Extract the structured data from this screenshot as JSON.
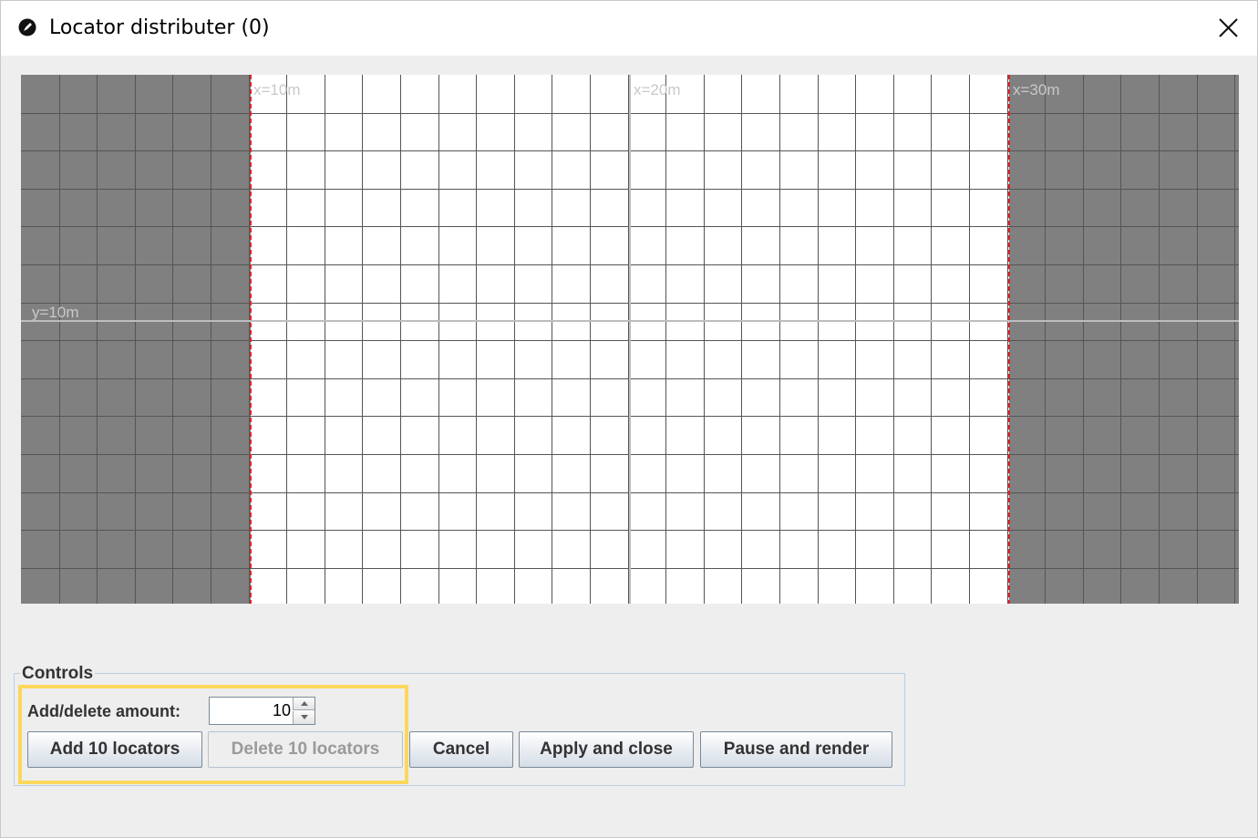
{
  "window": {
    "title": "Locator distributer (0)"
  },
  "canvas": {
    "x_labels": [
      "x=10m",
      "x=20m",
      "x=30m"
    ],
    "y_labels": [
      "y=10m"
    ],
    "colors": {
      "outside": "#808080",
      "inside": "#ffffff",
      "grid": "#555555",
      "major_axis": "#bdbdbd",
      "boundary": "#e0242e"
    }
  },
  "controls": {
    "legend": "Controls",
    "amount_label": "Add/delete amount:",
    "amount_value": "10",
    "buttons": {
      "add": "Add 10 locators",
      "delete": "Delete 10 locators",
      "cancel": "Cancel",
      "apply": "Apply and close",
      "pause": "Pause and render"
    },
    "highlight_color": "#fbd75b"
  }
}
